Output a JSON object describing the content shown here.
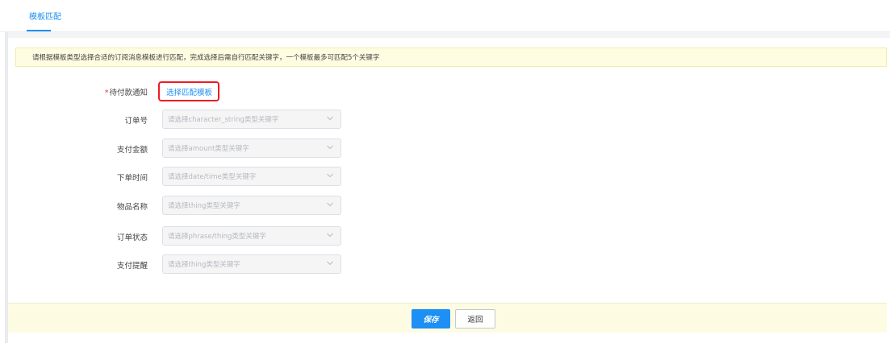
{
  "tabs": {
    "active_label": "模板匹配"
  },
  "notice": {
    "text": "请根据模板类型选择合适的订阅消息模板进行匹配，完成选择后需自行匹配关键字，一个模板最多可匹配5个关键字"
  },
  "template": {
    "required_mark": "*",
    "label": "待付款通知",
    "pick_link": "选择匹配模板"
  },
  "fields": [
    {
      "label": "订单号",
      "placeholder": "请选择character_string类型关键字"
    },
    {
      "label": "支付金额",
      "placeholder": "请选择amount类型关键字"
    },
    {
      "label": "下单时间",
      "placeholder": "请选择date/time类型关键字"
    },
    {
      "label": "物品名称",
      "placeholder": "请选择thing类型关键字"
    },
    {
      "label": "订单状态",
      "placeholder": "请选择phrase/thing类型关键字"
    },
    {
      "label": "支付提醒",
      "placeholder": "请选择thing类型关键字"
    }
  ],
  "footer": {
    "save_label": "保存",
    "back_label": "返回"
  },
  "colors": {
    "accent": "#1d8ff5",
    "highlight_box": "#ee1c25",
    "notice_bg": "#fefce1"
  },
  "icons": {
    "select_arrow": "chevron-down-icon"
  }
}
